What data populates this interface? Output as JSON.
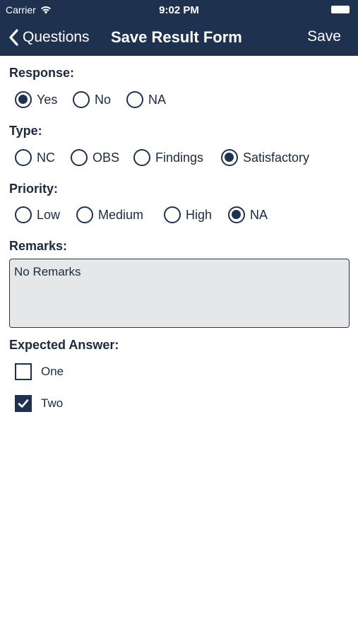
{
  "status_bar": {
    "carrier": "Carrier",
    "time": "9:02 PM"
  },
  "nav": {
    "back_label": "Questions",
    "title": "Save Result Form",
    "save_label": "Save"
  },
  "response": {
    "label": "Response:",
    "options": [
      {
        "label": "Yes",
        "selected": true
      },
      {
        "label": "No",
        "selected": false
      },
      {
        "label": "NA",
        "selected": false
      }
    ]
  },
  "type": {
    "label": "Type:",
    "options": [
      {
        "label": "NC",
        "selected": false
      },
      {
        "label": "OBS",
        "selected": false
      },
      {
        "label": "Findings",
        "selected": false
      },
      {
        "label": "Satisfactory",
        "selected": true
      }
    ]
  },
  "priority": {
    "label": "Priority:",
    "options": [
      {
        "label": "Low",
        "selected": false
      },
      {
        "label": "Medium",
        "selected": false
      },
      {
        "label": "High",
        "selected": false
      },
      {
        "label": "NA",
        "selected": true
      }
    ]
  },
  "remarks": {
    "label": "Remarks:",
    "value": "No Remarks"
  },
  "expected_answer": {
    "label": "Expected Answer:",
    "options": [
      {
        "label": "One",
        "checked": false
      },
      {
        "label": "Two",
        "checked": true
      }
    ]
  },
  "colors": {
    "header_bg": "#1e3250",
    "accent": "#1e3250",
    "remarks_bg": "#e6e7e9"
  }
}
